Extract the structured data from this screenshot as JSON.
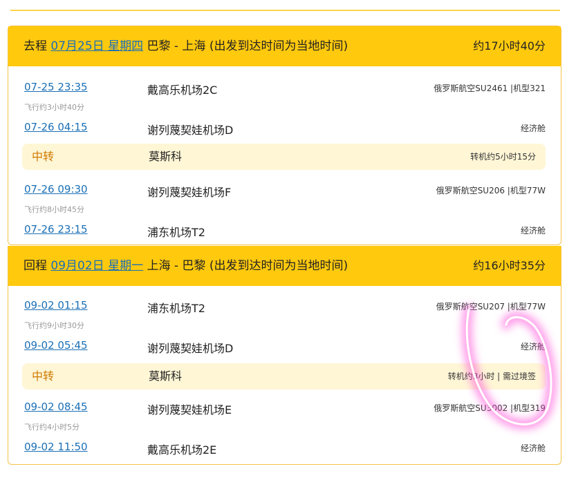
{
  "outbound": {
    "type_label": "去程",
    "date": "07月25日 星期四",
    "route": "巴黎 - 上海 (出发到达时间为当地时间)",
    "total_duration": "约17小时40分",
    "leg1": {
      "dep_time": "07-25 23:35",
      "dep_airport": "戴高乐机场2C",
      "flight_info": "俄罗斯航空SU2461 |机型321",
      "duration": "飞行约3小时40分",
      "arr_time": "07-26 04:15",
      "arr_airport": "谢列蔑契娃机场D",
      "cabin": "经济舱"
    },
    "transfer": {
      "label": "中转",
      "city": "莫斯科",
      "info": "转机约5小时15分"
    },
    "leg2": {
      "dep_time": "07-26 09:30",
      "dep_airport": "谢列蔑契娃机场F",
      "flight_info": "俄罗斯航空SU206 |机型77W",
      "duration": "飞行约8小时45分",
      "arr_time": "07-26 23:15",
      "arr_airport": "浦东机场T2",
      "cabin": "经济舱"
    }
  },
  "return": {
    "type_label": "回程",
    "date": "09月02日 星期一",
    "route": "上海 - 巴黎 (出发到达时间为当地时间)",
    "total_duration": "约16小时35分",
    "leg1": {
      "dep_time": "09-02 01:15",
      "dep_airport": "浦东机场T2",
      "flight_info": "俄罗斯航空SU207 |机型77W",
      "duration": "飞行约9小时30分",
      "arr_time": "09-02 05:45",
      "arr_airport": "谢列蔑契娃机场D",
      "cabin": "经济舱"
    },
    "transfer": {
      "label": "中转",
      "city": "莫斯科",
      "info": "转机约3小时 | 需过境签"
    },
    "leg2": {
      "dep_time": "09-02 08:45",
      "dep_airport": "谢列蔑契娃机场E",
      "flight_info": "俄罗斯航空SU3002 |机型319",
      "duration": "飞行约4小时5分",
      "arr_time": "09-02 11:50",
      "arr_airport": "戴高乐机场2E",
      "cabin": "经济舱"
    }
  },
  "colors": {
    "accent": "#ffc90e",
    "link": "#1a6fb5",
    "transfer_bg": "#fff6d6",
    "transfer_text": "#d07a00",
    "scribble": "#ff4fd8"
  }
}
